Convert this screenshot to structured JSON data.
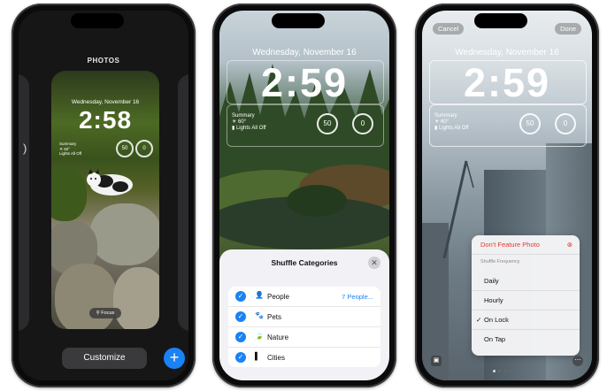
{
  "phone1": {
    "gallery_title": "PHOTOS",
    "lock": {
      "date": "Wednesday, November 16",
      "time": "2:58",
      "weather_summary": "Summary",
      "weather_line2": "☀ 60°",
      "weather_line3": "Lights All Off",
      "ring1": "50",
      "ring2": "0"
    },
    "focus_label": "Focus",
    "customize_label": "Customize",
    "page_dots": 4,
    "active_dot": 2
  },
  "phone2": {
    "lock": {
      "date": "Wednesday, November 16",
      "time": "2:59",
      "summary_title": "Summary",
      "summary_temp": "☀ 60°",
      "summary_lights": "▮ Lights All Off",
      "ring1": "50",
      "ring2": "0"
    },
    "sheet": {
      "title": "Shuffle Categories",
      "rows": [
        {
          "label": "People",
          "icon": "person-icon",
          "icon_glyph": "👤",
          "right": "7 People..."
        },
        {
          "label": "Pets",
          "icon": "paw-icon",
          "icon_glyph": "🐾",
          "right": ""
        },
        {
          "label": "Nature",
          "icon": "leaf-icon",
          "icon_glyph": "🍃",
          "right": ""
        },
        {
          "label": "Cities",
          "icon": "building-icon",
          "icon_glyph": "▌",
          "right": ""
        }
      ]
    }
  },
  "phone3": {
    "cancel_label": "Cancel",
    "done_label": "Done",
    "lock": {
      "date": "Wednesday, November 16",
      "time": "2:59",
      "summary_title": "Summary",
      "summary_temp": "☀ 60°",
      "summary_lights": "▮ Lights All Off",
      "ring1": "50",
      "ring2": "0"
    },
    "menu": {
      "feature_label": "Don't Feature Photo",
      "frequency_header": "Shuffle Frequency",
      "options": [
        "Daily",
        "Hourly",
        "On Lock",
        "On Tap"
      ],
      "selected": "On Lock"
    }
  },
  "colors": {
    "accent_blue": "#1a82f5",
    "destructive_red": "#e23b32",
    "sheet_bg": "#f2f2f6"
  }
}
